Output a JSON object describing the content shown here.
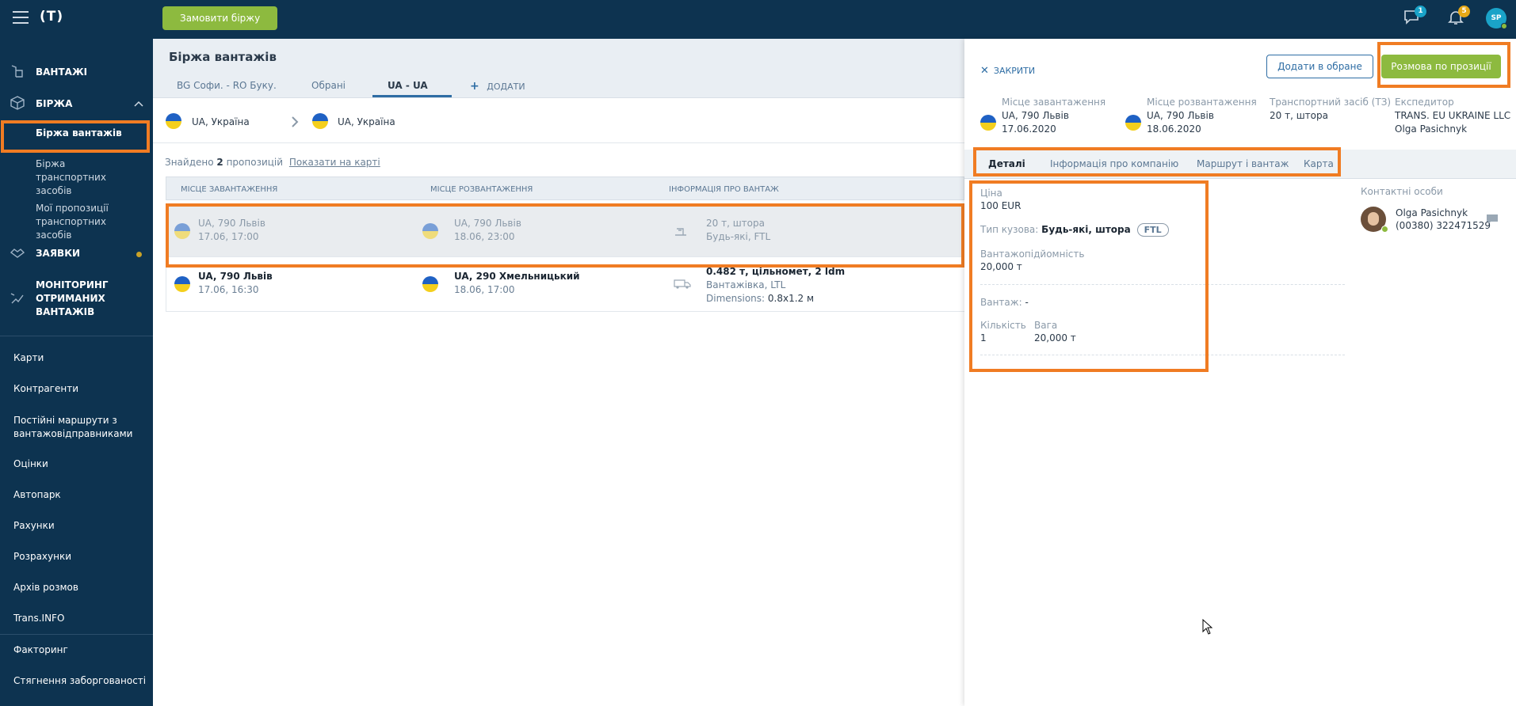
{
  "topbar": {
    "logo": "(T)",
    "order_button": "Замовити біржу",
    "messages_badge": "1",
    "notifications_badge": "5",
    "avatar_initials": "SP",
    "colors": {
      "bg": "#0d3350",
      "accent": "#8dba3f",
      "msg_badge": "#1aa3c8",
      "notif_badge": "#e6a817"
    }
  },
  "sidebar": {
    "sections": [
      {
        "label": "ВАНТАЖІ",
        "icon": "cargo-icon"
      },
      {
        "label": "БІРЖА",
        "icon": "box-icon"
      },
      {
        "label": "ЗАЯВКИ",
        "icon": "handshake-icon"
      },
      {
        "label": "МОНІТОРИНГ ОТРИМАНИХ ВАНТАЖІВ",
        "icon": "monitoring-icon"
      }
    ],
    "sub_items": [
      "Біржа вантажів",
      "Біржа транспортних засобів",
      "Мої пропозиції транспортних засобів"
    ],
    "links": [
      "Карти",
      "Контрагенти",
      "Постійні маршрути з вантажовідправниками",
      "Оцінки",
      "Автопарк",
      "Рахунки",
      "Розрахунки",
      "Архів розмов",
      "Trans.INFO",
      "Факторинг",
      "Стягнення заборгованості"
    ]
  },
  "main": {
    "title": "Біржа вантажів",
    "tabs": [
      "BG Софи. - RO Буку.",
      "Обрані",
      "UA - UA"
    ],
    "add_tab": "ДОДАТИ",
    "route_from": "UA, Україна",
    "route_to": "UA, Україна",
    "found_prefix": "Знайдено",
    "found_count": "2",
    "found_suffix": "пропозицій",
    "show_map": "Показати на карті",
    "columns": [
      "МІСЦЕ ЗАВАНТАЖЕННЯ",
      "МІСЦЕ РОЗВАНТАЖЕННЯ",
      "ІНФОРМАЦІЯ ПРО ВАНТАЖ"
    ],
    "rows": [
      {
        "load_city": "UA, 790 Львів",
        "load_time": "17.06, 17:00",
        "unload_city": "UA, 790 Львів",
        "unload_time": "18.06, 23:00",
        "info1": "20 т, штора",
        "info2": "Будь-які, FTL"
      },
      {
        "load_city": "UA, 790 Львів",
        "load_time": "17.06, 16:30",
        "unload_city": "UA, 290 Хмельницький",
        "unload_time": "18.06, 17:00",
        "info1": "0.482 т, цільномет, 2 ldm",
        "info2": "Вантажівка, LTL",
        "info3_label": "Dimensions:",
        "info3_value": "0.8x1.2 м"
      }
    ]
  },
  "panel": {
    "close": "ЗАКРИТИ",
    "favorite_button": "Додати в обране",
    "talk_button": "Розмова по прозиції",
    "load_label": "Місце завантаження",
    "load_city": "UA, 790 Львів",
    "load_date": "17.06.2020",
    "unload_label": "Місце розвантаження",
    "unload_city": "UA, 790 Львів",
    "unload_date": "18.06.2020",
    "vehicle_label": "Транспортний засіб (ТЗ)",
    "vehicle_value": "20 т, штора",
    "forwarder_label": "Експедитор",
    "forwarder_company": "TRANS. EU UKRAINE LLC",
    "forwarder_person": "Olga Pasichnyk",
    "tabs": [
      "Деталі",
      "Інформація про компанію",
      "Маршрут і вантаж",
      "Карта"
    ],
    "price_label": "Ціна",
    "price_value": "100 EUR",
    "body_label": "Тип кузова:",
    "body_value": "Будь-які, штора",
    "body_pill": "FTL",
    "capacity_label": "Вантажопідйомність",
    "capacity_value": "20,000 т",
    "cargo_label": "Вантаж:",
    "cargo_value": "-",
    "qty_label": "Кількість",
    "qty_value": "1",
    "weight_label": "Вага",
    "weight_value": "20,000 т",
    "contacts_label": "Контактні особи",
    "contact_name": "Olga Pasichnyk",
    "contact_phone": "(00380) 322471529"
  }
}
